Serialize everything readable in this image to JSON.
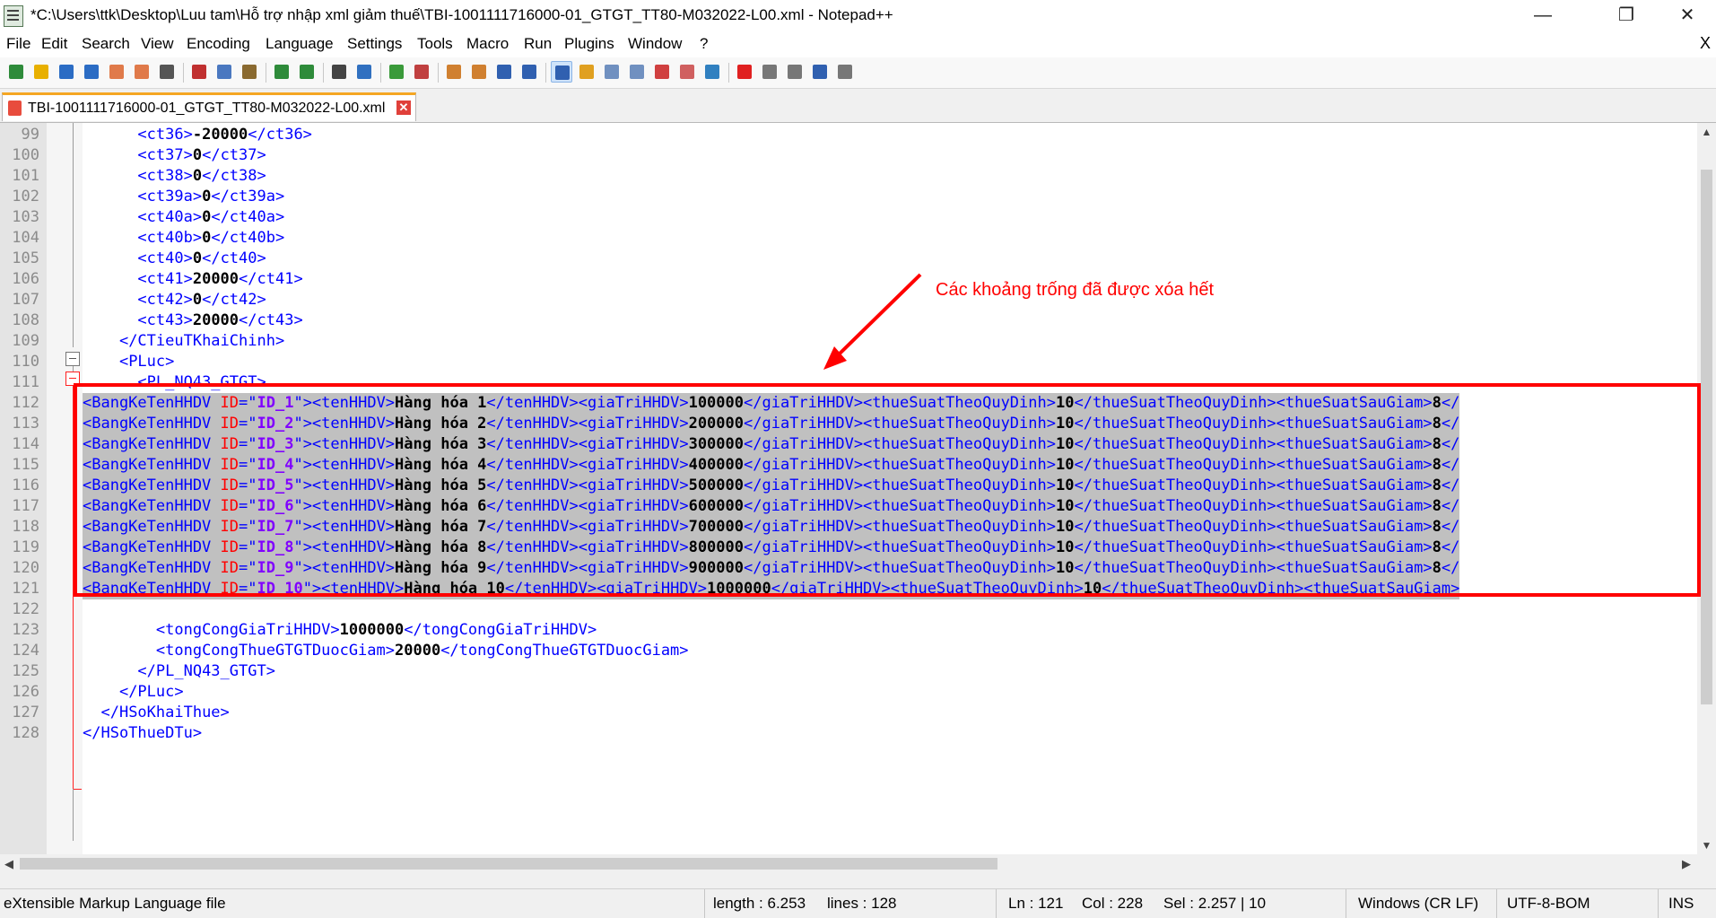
{
  "window": {
    "title": "*C:\\Users\\ttk\\Desktop\\Luu tam\\Hỗ trợ nhập xml giảm thuế\\TBI-1001111716000-01_GTGT_TT80-M032022-L00.xml - Notepad++",
    "app_icon": "notepad-plus-plus-icon",
    "controls": {
      "minimize": "—",
      "maximize": "❐",
      "close": "✕"
    }
  },
  "menu": {
    "items": [
      "File",
      "Edit",
      "Search",
      "View",
      "Encoding",
      "Language",
      "Settings",
      "Tools",
      "Macro",
      "Run",
      "Plugins",
      "Window",
      "?"
    ],
    "close_doc": "X"
  },
  "toolbar": {
    "buttons": [
      {
        "icon": "new-file-icon",
        "color": "#2e8b3a"
      },
      {
        "icon": "open-file-icon",
        "color": "#e8b000"
      },
      {
        "icon": "save-icon",
        "color": "#2b6cc4"
      },
      {
        "icon": "save-all-icon",
        "color": "#2b6cc4"
      },
      {
        "icon": "close-icon",
        "color": "#e07a4a"
      },
      {
        "icon": "close-all-icon",
        "color": "#e07a4a"
      },
      {
        "icon": "print-icon",
        "color": "#555555"
      },
      {
        "icon": "cut-icon",
        "color": "#c03030"
      },
      {
        "icon": "copy-icon",
        "color": "#4a78c0"
      },
      {
        "icon": "paste-icon",
        "color": "#8a6a30"
      },
      {
        "icon": "undo-icon",
        "color": "#2e8b3a"
      },
      {
        "icon": "redo-icon",
        "color": "#2e8b3a"
      },
      {
        "icon": "find-icon",
        "color": "#444444"
      },
      {
        "icon": "replace-icon",
        "color": "#3070c0"
      },
      {
        "icon": "zoom-in-icon",
        "color": "#3a9a3a"
      },
      {
        "icon": "zoom-out-icon",
        "color": "#c04040"
      },
      {
        "icon": "sync-vertical-icon",
        "color": "#d08030"
      },
      {
        "icon": "sync-horizontal-icon",
        "color": "#d08030"
      },
      {
        "icon": "word-wrap-icon",
        "color": "#3060b0"
      },
      {
        "icon": "show-all-chars-icon",
        "color": "#3060b0"
      },
      {
        "icon": "indent-guide-icon",
        "color": "#3060b0",
        "active": true
      },
      {
        "icon": "user-language-icon",
        "color": "#e0a020"
      },
      {
        "icon": "doc-map-icon",
        "color": "#7090c0"
      },
      {
        "icon": "function-list-icon",
        "color": "#7090c0"
      },
      {
        "icon": "folder-workspace-icon",
        "color": "#d04040"
      },
      {
        "icon": "monitoring-icon",
        "color": "#d06060"
      },
      {
        "icon": "eye-icon",
        "color": "#3080c0"
      },
      {
        "icon": "record-macro-icon",
        "color": "#e02020"
      },
      {
        "icon": "stop-macro-icon",
        "color": "#777777"
      },
      {
        "icon": "play-macro-icon",
        "color": "#777777"
      },
      {
        "icon": "play-multiple-icon",
        "color": "#3060b0"
      },
      {
        "icon": "save-macro-icon",
        "color": "#777777"
      }
    ]
  },
  "tab": {
    "label": "TBI-1001111716000-01_GTGT_TT80-M032022-L00.xml",
    "file_icon": "file-modified-icon",
    "close_icon": "tab-close-icon",
    "close_glyph": "✕"
  },
  "editor": {
    "lines": [
      {
        "n": "99",
        "segs": [
          [
            "indent",
            "      "
          ],
          [
            "tag",
            "<ct36>"
          ],
          [
            "txt",
            "-20000"
          ],
          [
            "tag",
            "</ct36>"
          ]
        ]
      },
      {
        "n": "100",
        "segs": [
          [
            "indent",
            "      "
          ],
          [
            "tag",
            "<ct37>"
          ],
          [
            "txt",
            "0"
          ],
          [
            "tag",
            "</ct37>"
          ]
        ]
      },
      {
        "n": "101",
        "segs": [
          [
            "indent",
            "      "
          ],
          [
            "tag",
            "<ct38>"
          ],
          [
            "txt",
            "0"
          ],
          [
            "tag",
            "</ct38>"
          ]
        ]
      },
      {
        "n": "102",
        "segs": [
          [
            "indent",
            "      "
          ],
          [
            "tag",
            "<ct39a>"
          ],
          [
            "txt",
            "0"
          ],
          [
            "tag",
            "</ct39a>"
          ]
        ]
      },
      {
        "n": "103",
        "segs": [
          [
            "indent",
            "      "
          ],
          [
            "tag",
            "<ct40a>"
          ],
          [
            "txt",
            "0"
          ],
          [
            "tag",
            "</ct40a>"
          ]
        ]
      },
      {
        "n": "104",
        "segs": [
          [
            "indent",
            "      "
          ],
          [
            "tag",
            "<ct40b>"
          ],
          [
            "txt",
            "0"
          ],
          [
            "tag",
            "</ct40b>"
          ]
        ]
      },
      {
        "n": "105",
        "segs": [
          [
            "indent",
            "      "
          ],
          [
            "tag",
            "<ct40>"
          ],
          [
            "txt",
            "0"
          ],
          [
            "tag",
            "</ct40>"
          ]
        ]
      },
      {
        "n": "106",
        "segs": [
          [
            "indent",
            "      "
          ],
          [
            "tag",
            "<ct41>"
          ],
          [
            "txt",
            "20000"
          ],
          [
            "tag",
            "</ct41>"
          ]
        ]
      },
      {
        "n": "107",
        "segs": [
          [
            "indent",
            "      "
          ],
          [
            "tag",
            "<ct42>"
          ],
          [
            "txt",
            "0"
          ],
          [
            "tag",
            "</ct42>"
          ]
        ]
      },
      {
        "n": "108",
        "segs": [
          [
            "indent",
            "      "
          ],
          [
            "tag",
            "<ct43>"
          ],
          [
            "txt",
            "20000"
          ],
          [
            "tag",
            "</ct43>"
          ]
        ]
      },
      {
        "n": "109",
        "segs": [
          [
            "indent",
            "    "
          ],
          [
            "tag",
            "</CTieuTKhaiChinh>"
          ]
        ]
      },
      {
        "n": "110",
        "segs": [
          [
            "indent",
            "    "
          ],
          [
            "tag",
            "<PLuc>"
          ]
        ]
      },
      {
        "n": "111",
        "segs": [
          [
            "indent",
            "      "
          ],
          [
            "tag",
            "<PL_NQ43_GTGT>"
          ]
        ]
      },
      {
        "n": "112",
        "sel": true,
        "segs": [
          [
            "tag",
            "<BangKeTenHHDV "
          ],
          [
            "attr",
            "ID"
          ],
          [
            "tag",
            "=\""
          ],
          [
            "val",
            "ID_1"
          ],
          [
            "tag",
            "\"><tenHHDV>"
          ],
          [
            "txt",
            "Hàng hóa 1"
          ],
          [
            "tag",
            "</tenHHDV><giaTriHHDV>"
          ],
          [
            "txt",
            "100000"
          ],
          [
            "tag",
            "</giaTriHHDV><thueSuatTheoQuyDinh>"
          ],
          [
            "txt",
            "10"
          ],
          [
            "tag",
            "</thueSuatTheoQuyDinh><thueSuatSauGiam>"
          ],
          [
            "txt",
            "8"
          ],
          [
            "tag",
            "</"
          ]
        ]
      },
      {
        "n": "113",
        "sel": true,
        "segs": [
          [
            "tag",
            "<BangKeTenHHDV "
          ],
          [
            "attr",
            "ID"
          ],
          [
            "tag",
            "=\""
          ],
          [
            "val",
            "ID_2"
          ],
          [
            "tag",
            "\"><tenHHDV>"
          ],
          [
            "txt",
            "Hàng hóa 2"
          ],
          [
            "tag",
            "</tenHHDV><giaTriHHDV>"
          ],
          [
            "txt",
            "200000"
          ],
          [
            "tag",
            "</giaTriHHDV><thueSuatTheoQuyDinh>"
          ],
          [
            "txt",
            "10"
          ],
          [
            "tag",
            "</thueSuatTheoQuyDinh><thueSuatSauGiam>"
          ],
          [
            "txt",
            "8"
          ],
          [
            "tag",
            "</"
          ]
        ]
      },
      {
        "n": "114",
        "sel": true,
        "segs": [
          [
            "tag",
            "<BangKeTenHHDV "
          ],
          [
            "attr",
            "ID"
          ],
          [
            "tag",
            "=\""
          ],
          [
            "val",
            "ID_3"
          ],
          [
            "tag",
            "\"><tenHHDV>"
          ],
          [
            "txt",
            "Hàng hóa 3"
          ],
          [
            "tag",
            "</tenHHDV><giaTriHHDV>"
          ],
          [
            "txt",
            "300000"
          ],
          [
            "tag",
            "</giaTriHHDV><thueSuatTheoQuyDinh>"
          ],
          [
            "txt",
            "10"
          ],
          [
            "tag",
            "</thueSuatTheoQuyDinh><thueSuatSauGiam>"
          ],
          [
            "txt",
            "8"
          ],
          [
            "tag",
            "</"
          ]
        ]
      },
      {
        "n": "115",
        "sel": true,
        "segs": [
          [
            "tag",
            "<BangKeTenHHDV "
          ],
          [
            "attr",
            "ID"
          ],
          [
            "tag",
            "=\""
          ],
          [
            "val",
            "ID_4"
          ],
          [
            "tag",
            "\"><tenHHDV>"
          ],
          [
            "txt",
            "Hàng hóa 4"
          ],
          [
            "tag",
            "</tenHHDV><giaTriHHDV>"
          ],
          [
            "txt",
            "400000"
          ],
          [
            "tag",
            "</giaTriHHDV><thueSuatTheoQuyDinh>"
          ],
          [
            "txt",
            "10"
          ],
          [
            "tag",
            "</thueSuatTheoQuyDinh><thueSuatSauGiam>"
          ],
          [
            "txt",
            "8"
          ],
          [
            "tag",
            "</"
          ]
        ]
      },
      {
        "n": "116",
        "sel": true,
        "segs": [
          [
            "tag",
            "<BangKeTenHHDV "
          ],
          [
            "attr",
            "ID"
          ],
          [
            "tag",
            "=\""
          ],
          [
            "val",
            "ID_5"
          ],
          [
            "tag",
            "\"><tenHHDV>"
          ],
          [
            "txt",
            "Hàng hóa 5"
          ],
          [
            "tag",
            "</tenHHDV><giaTriHHDV>"
          ],
          [
            "txt",
            "500000"
          ],
          [
            "tag",
            "</giaTriHHDV><thueSuatTheoQuyDinh>"
          ],
          [
            "txt",
            "10"
          ],
          [
            "tag",
            "</thueSuatTheoQuyDinh><thueSuatSauGiam>"
          ],
          [
            "txt",
            "8"
          ],
          [
            "tag",
            "</"
          ]
        ]
      },
      {
        "n": "117",
        "sel": true,
        "segs": [
          [
            "tag",
            "<BangKeTenHHDV "
          ],
          [
            "attr",
            "ID"
          ],
          [
            "tag",
            "=\""
          ],
          [
            "val",
            "ID_6"
          ],
          [
            "tag",
            "\"><tenHHDV>"
          ],
          [
            "txt",
            "Hàng hóa 6"
          ],
          [
            "tag",
            "</tenHHDV><giaTriHHDV>"
          ],
          [
            "txt",
            "600000"
          ],
          [
            "tag",
            "</giaTriHHDV><thueSuatTheoQuyDinh>"
          ],
          [
            "txt",
            "10"
          ],
          [
            "tag",
            "</thueSuatTheoQuyDinh><thueSuatSauGiam>"
          ],
          [
            "txt",
            "8"
          ],
          [
            "tag",
            "</"
          ]
        ]
      },
      {
        "n": "118",
        "sel": true,
        "segs": [
          [
            "tag",
            "<BangKeTenHHDV "
          ],
          [
            "attr",
            "ID"
          ],
          [
            "tag",
            "=\""
          ],
          [
            "val",
            "ID_7"
          ],
          [
            "tag",
            "\"><tenHHDV>"
          ],
          [
            "txt",
            "Hàng hóa 7"
          ],
          [
            "tag",
            "</tenHHDV><giaTriHHDV>"
          ],
          [
            "txt",
            "700000"
          ],
          [
            "tag",
            "</giaTriHHDV><thueSuatTheoQuyDinh>"
          ],
          [
            "txt",
            "10"
          ],
          [
            "tag",
            "</thueSuatTheoQuyDinh><thueSuatSauGiam>"
          ],
          [
            "txt",
            "8"
          ],
          [
            "tag",
            "</"
          ]
        ]
      },
      {
        "n": "119",
        "sel": true,
        "segs": [
          [
            "tag",
            "<BangKeTenHHDV "
          ],
          [
            "attr",
            "ID"
          ],
          [
            "tag",
            "=\""
          ],
          [
            "val",
            "ID_8"
          ],
          [
            "tag",
            "\"><tenHHDV>"
          ],
          [
            "txt",
            "Hàng hóa 8"
          ],
          [
            "tag",
            "</tenHHDV><giaTriHHDV>"
          ],
          [
            "txt",
            "800000"
          ],
          [
            "tag",
            "</giaTriHHDV><thueSuatTheoQuyDinh>"
          ],
          [
            "txt",
            "10"
          ],
          [
            "tag",
            "</thueSuatTheoQuyDinh><thueSuatSauGiam>"
          ],
          [
            "txt",
            "8"
          ],
          [
            "tag",
            "</"
          ]
        ]
      },
      {
        "n": "120",
        "sel": true,
        "segs": [
          [
            "tag",
            "<BangKeTenHHDV "
          ],
          [
            "attr",
            "ID"
          ],
          [
            "tag",
            "=\""
          ],
          [
            "val",
            "ID_9"
          ],
          [
            "tag",
            "\"><tenHHDV>"
          ],
          [
            "txt",
            "Hàng hóa 9"
          ],
          [
            "tag",
            "</tenHHDV><giaTriHHDV>"
          ],
          [
            "txt",
            "900000"
          ],
          [
            "tag",
            "</giaTriHHDV><thueSuatTheoQuyDinh>"
          ],
          [
            "txt",
            "10"
          ],
          [
            "tag",
            "</thueSuatTheoQuyDinh><thueSuatSauGiam>"
          ],
          [
            "txt",
            "8"
          ],
          [
            "tag",
            "</"
          ]
        ]
      },
      {
        "n": "121",
        "sel": true,
        "segs": [
          [
            "tag",
            "<BangKeTenHHDV "
          ],
          [
            "attr",
            "ID"
          ],
          [
            "tag",
            "=\""
          ],
          [
            "val",
            "ID_10"
          ],
          [
            "tag",
            "\"><tenHHDV>"
          ],
          [
            "txt",
            "Hàng hóa 10"
          ],
          [
            "tag",
            "</tenHHDV><giaTriHHDV>"
          ],
          [
            "txt",
            "1000000"
          ],
          [
            "tag",
            "</giaTriHHDV><thueSuatTheoQuyDinh>"
          ],
          [
            "txt",
            "10"
          ],
          [
            "tag",
            "</thueSuatTheoQuyDinh><thueSuatSauGiam>"
          ]
        ]
      },
      {
        "n": "122",
        "segs": []
      },
      {
        "n": "123",
        "segs": [
          [
            "indent",
            "        "
          ],
          [
            "tag",
            "<tongCongGiaTriHHDV>"
          ],
          [
            "txt",
            "1000000"
          ],
          [
            "tag",
            "</tongCongGiaTriHHDV>"
          ]
        ]
      },
      {
        "n": "124",
        "segs": [
          [
            "indent",
            "        "
          ],
          [
            "tag",
            "<tongCongThueGTGTDuocGiam>"
          ],
          [
            "txt",
            "20000"
          ],
          [
            "tag",
            "</tongCongThueGTGTDuocGiam>"
          ]
        ]
      },
      {
        "n": "125",
        "segs": [
          [
            "indent",
            "      "
          ],
          [
            "tag",
            "</PL_NQ43_GTGT>"
          ]
        ]
      },
      {
        "n": "126",
        "segs": [
          [
            "indent",
            "    "
          ],
          [
            "tag",
            "</PLuc>"
          ]
        ]
      },
      {
        "n": "127",
        "segs": [
          [
            "indent",
            "  "
          ],
          [
            "tag",
            "</HSoKhaiThue>"
          ]
        ]
      },
      {
        "n": "128",
        "segs": [
          [
            "tag",
            "</HSoThueDTu>"
          ]
        ]
      }
    ]
  },
  "annotation": {
    "text": "Các khoảng trống đã được xóa hết",
    "color": "#ff0000"
  },
  "statusbar": {
    "file_type": "eXtensible Markup Language file",
    "length": "length : 6.253",
    "lines": "lines : 128",
    "ln": "Ln : 121",
    "col": "Col : 228",
    "sel": "Sel : 2.257 | 10",
    "eol": "Windows (CR LF)",
    "encoding": "UTF-8-BOM",
    "mode": "INS"
  },
  "scrollbars": {
    "up": "▲",
    "down": "▼",
    "left": "◀",
    "right": "▶"
  }
}
